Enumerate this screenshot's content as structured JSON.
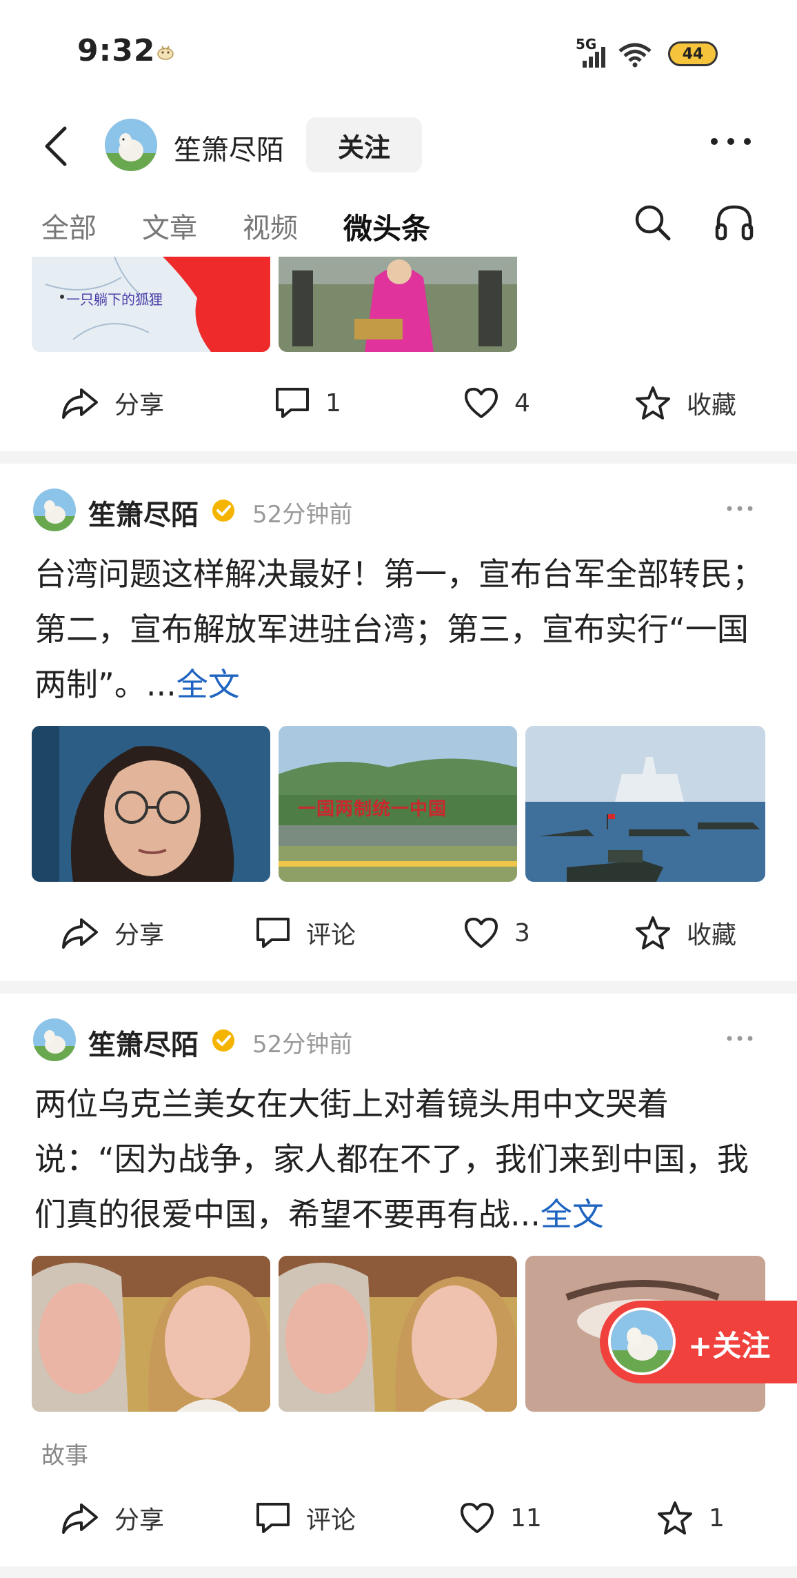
{
  "status": {
    "time": "9:32",
    "network": "5G",
    "battery": "44"
  },
  "header": {
    "author": "笙箫尽陌",
    "follow_label": "关注"
  },
  "tabs": [
    {
      "label": "全部"
    },
    {
      "label": "文章"
    },
    {
      "label": "视频"
    },
    {
      "label": "微头条"
    }
  ],
  "post0": {
    "map_label": "一只躺下的狐狸",
    "share": "分享",
    "comments": "1",
    "likes": "4",
    "collect": "收藏"
  },
  "post1": {
    "author": "笙箫尽陌",
    "time": "52分钟前",
    "text": "台湾问题这样解决最好！第一，宣布台军全部转民；第二，宣布解放军进驻台湾；第三，宣布实行“一国两制”。...",
    "fulltext": "全文",
    "sign_text": "一国两制统一中国",
    "share": "分享",
    "comment": "评论",
    "likes": "3",
    "collect": "收藏"
  },
  "post2": {
    "author": "笙箫尽陌",
    "time": "52分钟前",
    "text": "两位乌克兰美女在大街上对着镜头用中文哭着说：“因为战争，家人都在不了，我们来到中国，我们真的很爱中国，希望不要再有战...",
    "fulltext": "全文",
    "tag": "故事",
    "share": "分享",
    "comment": "评论",
    "likes": "11",
    "collect": "1"
  },
  "float": {
    "label": "+关注"
  },
  "colors": {
    "accent_red": "#f0413d",
    "link_blue": "#1f64c0",
    "verified_gold": "#f5b400"
  }
}
